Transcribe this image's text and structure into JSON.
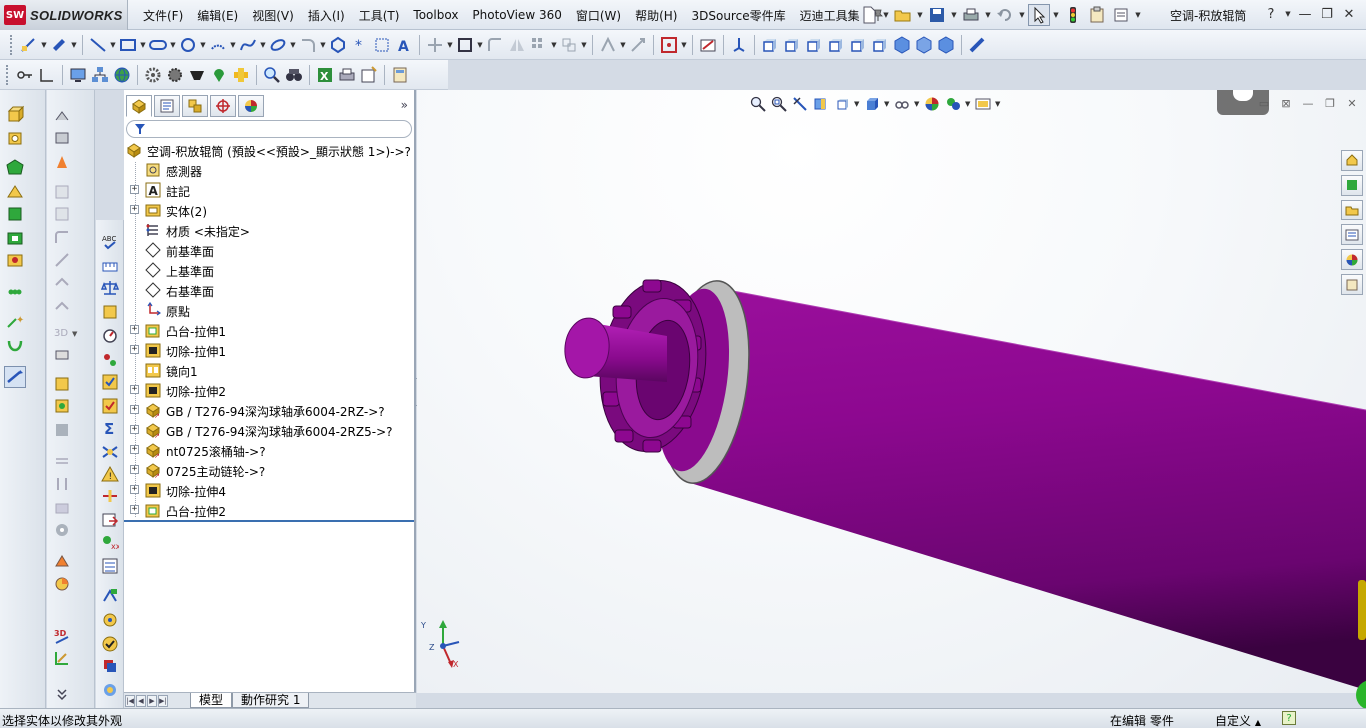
{
  "app": {
    "brand": "SOLIDWORKS",
    "logo_mark": "SW",
    "document_title": "空调-积放辊筒"
  },
  "menu": {
    "items": [
      "文件(F)",
      "编辑(E)",
      "视图(V)",
      "插入(I)",
      "工具(T)",
      "Toolbox",
      "PhotoView 360",
      "窗口(W)",
      "帮助(H)",
      "3DSource零件库",
      "迈迪工具集"
    ]
  },
  "window_controls": {
    "help": "?",
    "minimize": "—",
    "restore": "❐",
    "close": "✕"
  },
  "feature_manager": {
    "root": "空调-积放辊筒  (預設<<預設>_顯示狀態 1>)->?",
    "items": [
      {
        "label": "感測器",
        "icon": "sensor-icon",
        "expandable": false
      },
      {
        "label": "註記",
        "icon": "annotation-icon",
        "expandable": true
      },
      {
        "label": "实体(2)",
        "icon": "solid-bodies-icon",
        "expandable": true
      },
      {
        "label": "材质 <未指定>",
        "icon": "material-icon",
        "expandable": false
      },
      {
        "label": "前基準面",
        "icon": "plane-icon",
        "expandable": false
      },
      {
        "label": "上基準面",
        "icon": "plane-icon",
        "expandable": false
      },
      {
        "label": "右基準面",
        "icon": "plane-icon",
        "expandable": false
      },
      {
        "label": "原點",
        "icon": "origin-icon",
        "expandable": false
      },
      {
        "label": "凸台-拉伸1",
        "icon": "boss-extrude-icon",
        "expandable": true
      },
      {
        "label": "切除-拉伸1",
        "icon": "cut-extrude-icon",
        "expandable": true
      },
      {
        "label": "镜向1",
        "icon": "mirror-icon",
        "expandable": false
      },
      {
        "label": "切除-拉伸2",
        "icon": "cut-extrude-icon",
        "expandable": true
      },
      {
        "label": "GB / T276-94深沟球轴承6004-2RZ->?",
        "icon": "part-icon",
        "expandable": true
      },
      {
        "label": "GB / T276-94深沟球轴承6004-2RZ5->?",
        "icon": "part-icon",
        "expandable": true
      },
      {
        "label": "nt0725滚桶轴->?",
        "icon": "part-icon",
        "expandable": true
      },
      {
        "label": "0725主动链轮->?",
        "icon": "part-icon",
        "expandable": true
      },
      {
        "label": "切除-拉伸4",
        "icon": "cut-extrude-icon",
        "expandable": true
      },
      {
        "label": "凸台-拉伸2",
        "icon": "boss-extrude-icon",
        "expandable": true
      }
    ],
    "collapse_glyph": "»"
  },
  "bottom_tabs": {
    "model": "模型",
    "motion_study": "動作研究 1"
  },
  "triad": {
    "x": "X",
    "y": "Y",
    "z": "Z"
  },
  "status": {
    "message": "选择实体以修改其外观",
    "mode": "在编辑 零件",
    "units": "自定义",
    "units_arrow": "▲",
    "help": "?"
  },
  "colors": {
    "model_purple": "#8a0a8a",
    "ring_gray": "#b5b5b5",
    "accent_blue": "#3a6fb0"
  }
}
